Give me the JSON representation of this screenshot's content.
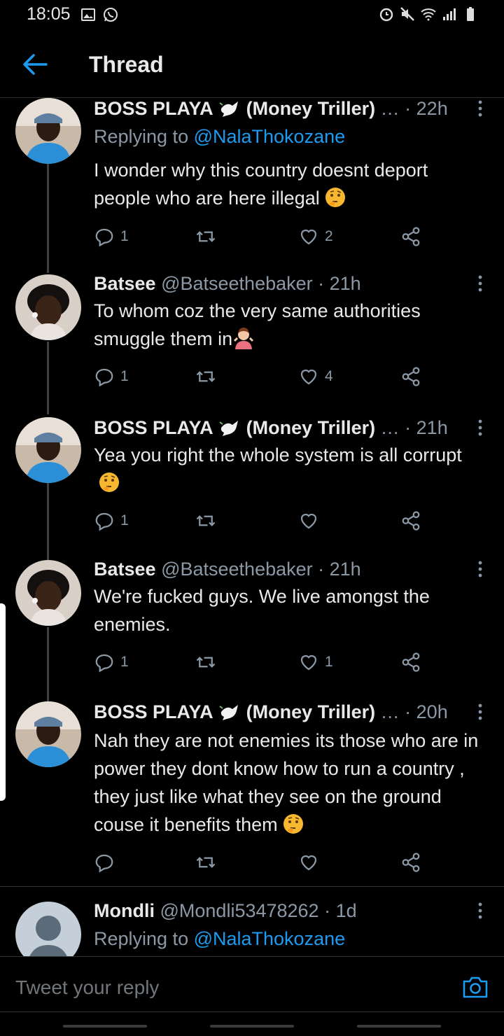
{
  "status_bar": {
    "time": "18:05",
    "left_icons": [
      "gallery-icon",
      "whatsapp-icon"
    ],
    "right_icons": [
      "alarm-icon",
      "mute-icon",
      "wifi-icon",
      "signal-icon",
      "battery-icon"
    ]
  },
  "header": {
    "title": "Thread"
  },
  "tweets": [
    {
      "name": "BOSS PLAYA",
      "name_suffix": "(Money Triller)",
      "name_emoji": "dove-icon",
      "handle": "…",
      "time": "· 22h",
      "replying_prefix": "Replying to ",
      "replying_to": "@NalaThokozane",
      "text": "I wonder why this country doesnt deport people who are here illegal",
      "emoji": "thinking-face-emoji",
      "replies": "1",
      "retweets": "",
      "likes": "2"
    },
    {
      "name": "Batsee",
      "handle": "@Batseethebaker",
      "time": "· 21h",
      "text": "To whom coz the very same authorities smuggle them in",
      "emoji": "woman-shrugging-emoji",
      "replies": "1",
      "retweets": "",
      "likes": "4"
    },
    {
      "name": "BOSS PLAYA",
      "name_suffix": "(Money Triller)",
      "name_emoji": "dove-icon",
      "handle": "…",
      "time": "· 21h",
      "text": "Yea you right the whole system is all corrupt",
      "emoji": "thinking-face-emoji",
      "replies": "1",
      "retweets": "",
      "likes": ""
    },
    {
      "name": "Batsee",
      "handle": "@Batseethebaker",
      "time": "· 21h",
      "text": "We're fucked guys. We live amongst the enemies.",
      "replies": "1",
      "retweets": "",
      "likes": "1"
    },
    {
      "name": "BOSS PLAYA",
      "name_suffix": "(Money Triller)",
      "name_emoji": "dove-icon",
      "handle": "…",
      "time": "· 20h",
      "text": "Nah they are not enemies its those who are in power they dont know how to run a country  , they just like what they see on the ground couse it benefits them",
      "emoji": "thinking-face-emoji",
      "replies": "",
      "retweets": "",
      "likes": ""
    },
    {
      "name": "Mondli",
      "handle": "@Mondli53478262",
      "time": "· 1d",
      "replying_prefix": "Replying to ",
      "replying_to": "@NalaThokozane"
    }
  ],
  "composer": {
    "placeholder": "Tweet your reply"
  },
  "colors": {
    "background": "#000000",
    "accent": "#1d9bf0",
    "secondary_text": "#8b98a5",
    "primary_text": "#e7e9ea"
  }
}
